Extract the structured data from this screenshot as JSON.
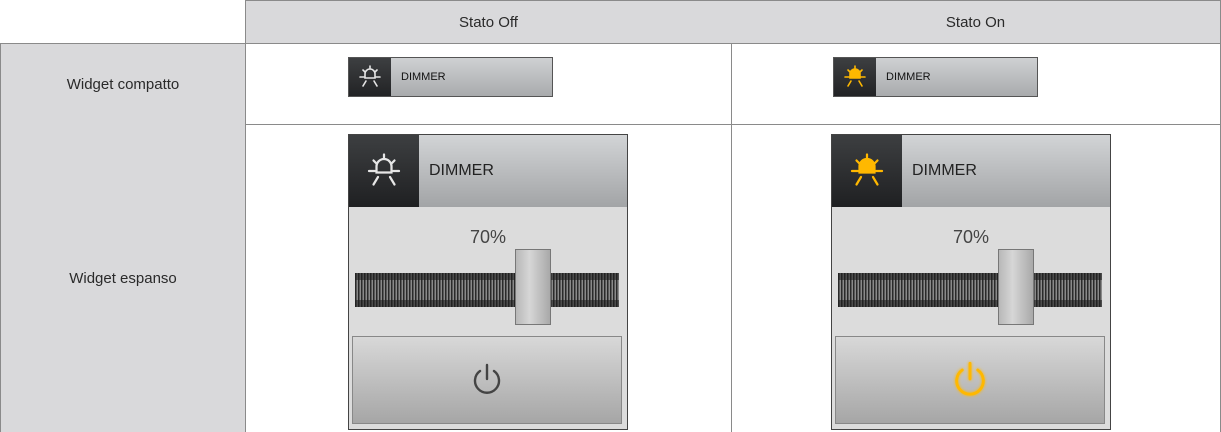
{
  "header": {
    "off_label": "Stato Off",
    "on_label": "Stato On"
  },
  "rows": {
    "compact_label": "Widget compatto",
    "expanded_label": "Widget espanso"
  },
  "compact_off": {
    "label": "DIMMER",
    "icon": "bulb-icon",
    "state": "off"
  },
  "compact_on": {
    "label": "DIMMER",
    "icon": "bulb-icon",
    "state": "on"
  },
  "expanded_off": {
    "label": "DIMMER",
    "icon": "bulb-icon",
    "level_text": "70%",
    "level": 70,
    "state": "off",
    "power_icon": "power-icon"
  },
  "expanded_on": {
    "label": "DIMMER",
    "icon": "bulb-icon",
    "level_text": "70%",
    "level": 70,
    "state": "on",
    "power_icon": "power-icon"
  },
  "colors": {
    "on": "#ffb800",
    "off": "#e6e6e6",
    "power_off": "#444444"
  }
}
